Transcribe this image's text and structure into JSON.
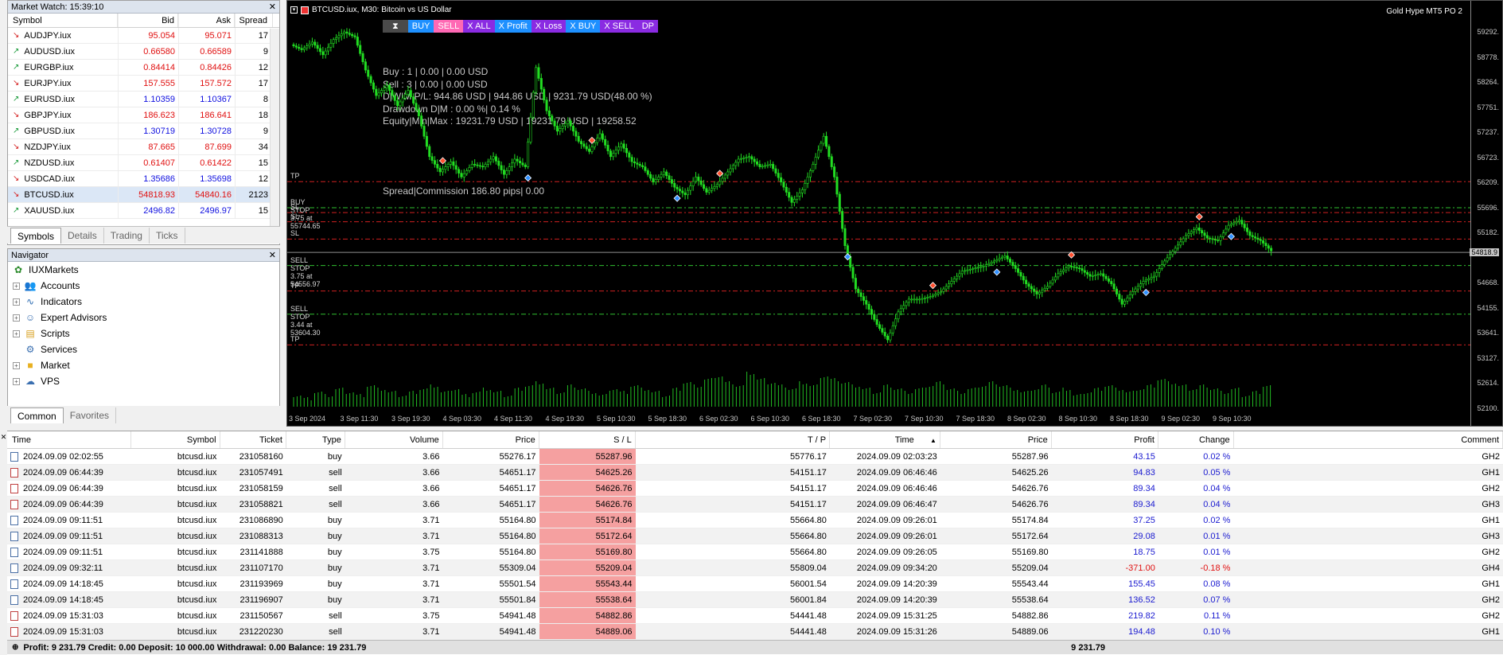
{
  "market_watch": {
    "title": "Market Watch: 15:39:10",
    "headers": {
      "symbol": "Symbol",
      "bid": "Bid",
      "ask": "Ask",
      "spread": "Spread"
    },
    "rows": [
      {
        "dir": "down",
        "symbol": "AUDJPY.iux",
        "bid": "95.054",
        "ask": "95.071",
        "spread": "17",
        "bid_color": "red"
      },
      {
        "dir": "up",
        "symbol": "AUDUSD.iux",
        "bid": "0.66580",
        "ask": "0.66589",
        "spread": "9",
        "bid_color": "red"
      },
      {
        "dir": "up",
        "symbol": "EURGBP.iux",
        "bid": "0.84414",
        "ask": "0.84426",
        "spread": "12",
        "bid_color": "red"
      },
      {
        "dir": "down",
        "symbol": "EURJPY.iux",
        "bid": "157.555",
        "ask": "157.572",
        "spread": "17",
        "bid_color": "red"
      },
      {
        "dir": "up",
        "symbol": "EURUSD.iux",
        "bid": "1.10359",
        "ask": "1.10367",
        "spread": "8",
        "bid_color": "blue"
      },
      {
        "dir": "down",
        "symbol": "GBPJPY.iux",
        "bid": "186.623",
        "ask": "186.641",
        "spread": "18",
        "bid_color": "red"
      },
      {
        "dir": "up",
        "symbol": "GBPUSD.iux",
        "bid": "1.30719",
        "ask": "1.30728",
        "spread": "9",
        "bid_color": "blue"
      },
      {
        "dir": "down",
        "symbol": "NZDJPY.iux",
        "bid": "87.665",
        "ask": "87.699",
        "spread": "34",
        "bid_color": "red"
      },
      {
        "dir": "up",
        "symbol": "NZDUSD.iux",
        "bid": "0.61407",
        "ask": "0.61422",
        "spread": "15",
        "bid_color": "red"
      },
      {
        "dir": "down",
        "symbol": "USDCAD.iux",
        "bid": "1.35686",
        "ask": "1.35698",
        "spread": "12",
        "bid_color": "blue"
      },
      {
        "dir": "down",
        "symbol": "BTCUSD.iux",
        "bid": "54818.93",
        "ask": "54840.16",
        "spread": "2123",
        "bid_color": "red",
        "selected": true
      },
      {
        "dir": "up",
        "symbol": "XAUUSD.iux",
        "bid": "2496.82",
        "ask": "2496.97",
        "spread": "15",
        "bid_color": "blue"
      }
    ],
    "tabs": [
      "Symbols",
      "Details",
      "Trading",
      "Ticks"
    ]
  },
  "navigator": {
    "title": "Navigator",
    "root": "IUXMarkets",
    "items": [
      {
        "label": "Accounts",
        "icon": "accounts-icon"
      },
      {
        "label": "Indicators",
        "icon": "indicators-icon"
      },
      {
        "label": "Expert Advisors",
        "icon": "expert-advisors-icon"
      },
      {
        "label": "Scripts",
        "icon": "scripts-icon"
      },
      {
        "label": "Services",
        "icon": "services-icon"
      },
      {
        "label": "Market",
        "icon": "market-icon"
      },
      {
        "label": "VPS",
        "icon": "vps-icon"
      }
    ],
    "tabs": [
      "Common",
      "Favorites"
    ]
  },
  "chart": {
    "title": "BTCUSD.iux, M30:  Bitcoin vs US Dollar",
    "ea_name": "Gold Hype MT5 PO 2",
    "buttons": [
      {
        "label": "",
        "bg": "#4a4a4a",
        "icon": "hourglass-icon"
      },
      {
        "label": "BUY",
        "bg": "#1e90ff"
      },
      {
        "label": "SELL",
        "bg": "#ff69b4"
      },
      {
        "label": "X ALL",
        "bg": "#8a2be2"
      },
      {
        "label": "X Profit",
        "bg": "#1e90ff"
      },
      {
        "label": "X Loss",
        "bg": "#8a2be2"
      },
      {
        "label": "X BUY",
        "bg": "#1e90ff"
      },
      {
        "label": "X SELL",
        "bg": "#8a2be2"
      },
      {
        "label": "DP",
        "bg": "#8a2be2"
      }
    ],
    "info_lines": [
      "Buy : 1 | 0.00 | 0.00 USD",
      "Sell : 3 | 0.00 | 0.00 USD",
      "D|W|M P/L: 944.86 USD | 944.86 USD | 9231.79 USD(48.00 %)",
      "Drawdown D|M : 0.00 %| 0.14 %",
      "Equity|Min|Max : 19231.79 USD | 19231.79 USD | 19258.52"
    ],
    "spread_text": "Spread|Commission 186.80 pips| 0.00",
    "level_labels": {
      "tp1": "TP",
      "buy_stop": "BUY STOP 3.75 at 55744.65",
      "sl1": "SL",
      "sl2": "SL",
      "sl3": "SL",
      "sell_stop1": "SELL STOP 3.75 at 54556.97",
      "tp2": "TP",
      "sell_stop2": "SELL STOP 3.44 at 53604.30",
      "tp3": "TP"
    },
    "price_labels": [
      "59292.",
      "58778.",
      "58264.",
      "57751.",
      "57237.",
      "56723.",
      "56209.",
      "55696.",
      "55182.",
      "54818.9",
      "54668.",
      "54155.",
      "53641.",
      "53127.",
      "52614.",
      "52100."
    ],
    "current_price": "54818.9",
    "time_labels": [
      "3 Sep 2024",
      "3 Sep 11:30",
      "3 Sep 19:30",
      "4 Sep 03:30",
      "4 Sep 11:30",
      "4 Sep 19:30",
      "5 Sep 10:30",
      "5 Sep 18:30",
      "6 Sep 02:30",
      "6 Sep 10:30",
      "6 Sep 18:30",
      "7 Sep 02:30",
      "7 Sep 10:30",
      "7 Sep 18:30",
      "8 Sep 02:30",
      "8 Sep 10:30",
      "8 Sep 18:30",
      "9 Sep 02:30",
      "9 Sep 10:30"
    ],
    "price_series": [
      58900,
      58800,
      58950,
      58700,
      59000,
      59150,
      59050,
      58400,
      57900,
      58100,
      57700,
      58000,
      57500,
      56700,
      56400,
      56600,
      56300,
      56550,
      56500,
      56700,
      56350,
      56650,
      56500,
      58450,
      57600,
      57200,
      57400,
      57000,
      56800,
      57150,
      56700,
      56950,
      56600,
      56500,
      56200,
      56400,
      56100,
      55950,
      56300,
      56000,
      56150,
      56400,
      56650,
      56700,
      56500,
      56550,
      56200,
      55800,
      56050,
      56550,
      57100,
      56300,
      54950,
      54100,
      53800,
      53400,
      53100,
      53650,
      53900,
      53900,
      53950,
      54050,
      54250,
      54450,
      54500,
      54550,
      54650,
      54750,
      54500,
      54200,
      54000,
      54150,
      54400,
      54550,
      54500,
      54350,
      54400,
      54200,
      53800,
      54050,
      54250,
      54350,
      54650,
      54900,
      55150,
      55300,
      55100,
      55050,
      55350,
      55450,
      55150,
      55050,
      54850
    ],
    "volume_bars": [
      3,
      2,
      4,
      3,
      5,
      4,
      3,
      6,
      5,
      4,
      3,
      4,
      5,
      6,
      4,
      5,
      3,
      4,
      5,
      4,
      3,
      5,
      6,
      7,
      5,
      4,
      6,
      5,
      4,
      3,
      5,
      4,
      6,
      5,
      4,
      3,
      5,
      7,
      6,
      8,
      9,
      7,
      6,
      10,
      8,
      7,
      6,
      5,
      7,
      6,
      9,
      8,
      7,
      6,
      5,
      4,
      6,
      5,
      4,
      5,
      6,
      7,
      5,
      4,
      5,
      6,
      7,
      6,
      5,
      4,
      5,
      6,
      4,
      5,
      3,
      4,
      5,
      6,
      5,
      4,
      5,
      6,
      8,
      7,
      6,
      5,
      6,
      5,
      4,
      5,
      3,
      4,
      6
    ]
  },
  "terminal": {
    "headers": [
      "Time",
      "Symbol",
      "Ticket",
      "Type",
      "Volume",
      "Price",
      "S / L",
      "T / P",
      "Time",
      "Price",
      "Profit",
      "Change",
      "Comment"
    ],
    "sort_arrow": "▲",
    "rows": [
      {
        "time": "2024.09.09 02:02:55",
        "symbol": "btcusd.iux",
        "ticket": "231058160",
        "type": "buy",
        "volume": "3.66",
        "price": "55276.17",
        "sl": "55287.96",
        "tp": "55776.17",
        "time2": "2024.09.09 02:03:23",
        "price2": "55287.96",
        "profit": "43.15",
        "change": "0.02 %",
        "comment": "GH2"
      },
      {
        "time": "2024.09.09 06:44:39",
        "symbol": "btcusd.iux",
        "ticket": "231057491",
        "type": "sell",
        "volume": "3.66",
        "price": "54651.17",
        "sl": "54625.26",
        "tp": "54151.17",
        "time2": "2024.09.09 06:46:46",
        "price2": "54625.26",
        "profit": "94.83",
        "change": "0.05 %",
        "comment": "GH1"
      },
      {
        "time": "2024.09.09 06:44:39",
        "symbol": "btcusd.iux",
        "ticket": "231058159",
        "type": "sell",
        "volume": "3.66",
        "price": "54651.17",
        "sl": "54626.76",
        "tp": "54151.17",
        "time2": "2024.09.09 06:46:46",
        "price2": "54626.76",
        "profit": "89.34",
        "change": "0.04 %",
        "comment": "GH2"
      },
      {
        "time": "2024.09.09 06:44:39",
        "symbol": "btcusd.iux",
        "ticket": "231058821",
        "type": "sell",
        "volume": "3.66",
        "price": "54651.17",
        "sl": "54626.76",
        "tp": "54151.17",
        "time2": "2024.09.09 06:46:47",
        "price2": "54626.76",
        "profit": "89.34",
        "change": "0.04 %",
        "comment": "GH3"
      },
      {
        "time": "2024.09.09 09:11:51",
        "symbol": "btcusd.iux",
        "ticket": "231086890",
        "type": "buy",
        "volume": "3.71",
        "price": "55164.80",
        "sl": "55174.84",
        "tp": "55664.80",
        "time2": "2024.09.09 09:26:01",
        "price2": "55174.84",
        "profit": "37.25",
        "change": "0.02 %",
        "comment": "GH1"
      },
      {
        "time": "2024.09.09 09:11:51",
        "symbol": "btcusd.iux",
        "ticket": "231088313",
        "type": "buy",
        "volume": "3.71",
        "price": "55164.80",
        "sl": "55172.64",
        "tp": "55664.80",
        "time2": "2024.09.09 09:26:01",
        "price2": "55172.64",
        "profit": "29.08",
        "change": "0.01 %",
        "comment": "GH3"
      },
      {
        "time": "2024.09.09 09:11:51",
        "symbol": "btcusd.iux",
        "ticket": "231141888",
        "type": "buy",
        "volume": "3.75",
        "price": "55164.80",
        "sl": "55169.80",
        "tp": "55664.80",
        "time2": "2024.09.09 09:26:05",
        "price2": "55169.80",
        "profit": "18.75",
        "change": "0.01 %",
        "comment": "GH2"
      },
      {
        "time": "2024.09.09 09:32:11",
        "symbol": "btcusd.iux",
        "ticket": "231107170",
        "type": "buy",
        "volume": "3.71",
        "price": "55309.04",
        "sl": "55209.04",
        "tp": "55809.04",
        "time2": "2024.09.09 09:34:20",
        "price2": "55209.04",
        "profit": "-371.00",
        "change": "-0.18 %",
        "comment": "GH4",
        "negative": true
      },
      {
        "time": "2024.09.09 14:18:45",
        "symbol": "btcusd.iux",
        "ticket": "231193969",
        "type": "buy",
        "volume": "3.71",
        "price": "55501.54",
        "sl": "55543.44",
        "tp": "56001.54",
        "time2": "2024.09.09 14:20:39",
        "price2": "55543.44",
        "profit": "155.45",
        "change": "0.08 %",
        "comment": "GH1"
      },
      {
        "time": "2024.09.09 14:18:45",
        "symbol": "btcusd.iux",
        "ticket": "231196907",
        "type": "buy",
        "volume": "3.71",
        "price": "55501.84",
        "sl": "55538.64",
        "tp": "56001.84",
        "time2": "2024.09.09 14:20:39",
        "price2": "55538.64",
        "profit": "136.52",
        "change": "0.07 %",
        "comment": "GH2"
      },
      {
        "time": "2024.09.09 15:31:03",
        "symbol": "btcusd.iux",
        "ticket": "231150567",
        "type": "sell",
        "volume": "3.75",
        "price": "54941.48",
        "sl": "54882.86",
        "tp": "54441.48",
        "time2": "2024.09.09 15:31:25",
        "price2": "54882.86",
        "profit": "219.82",
        "change": "0.11 %",
        "comment": "GH2"
      },
      {
        "time": "2024.09.09 15:31:03",
        "symbol": "btcusd.iux",
        "ticket": "231220230",
        "type": "sell",
        "volume": "3.71",
        "price": "54941.48",
        "sl": "54889.06",
        "tp": "54441.48",
        "time2": "2024.09.09 15:31:26",
        "price2": "54889.06",
        "profit": "194.48",
        "change": "0.10 %",
        "comment": "GH1"
      }
    ],
    "balance_line": "Profit: 9 231.79  Credit: 0.00  Deposit: 10 000.00  Withdrawal: 0.00  Balance: 19 231.79",
    "balance_total": "9 231.79"
  }
}
